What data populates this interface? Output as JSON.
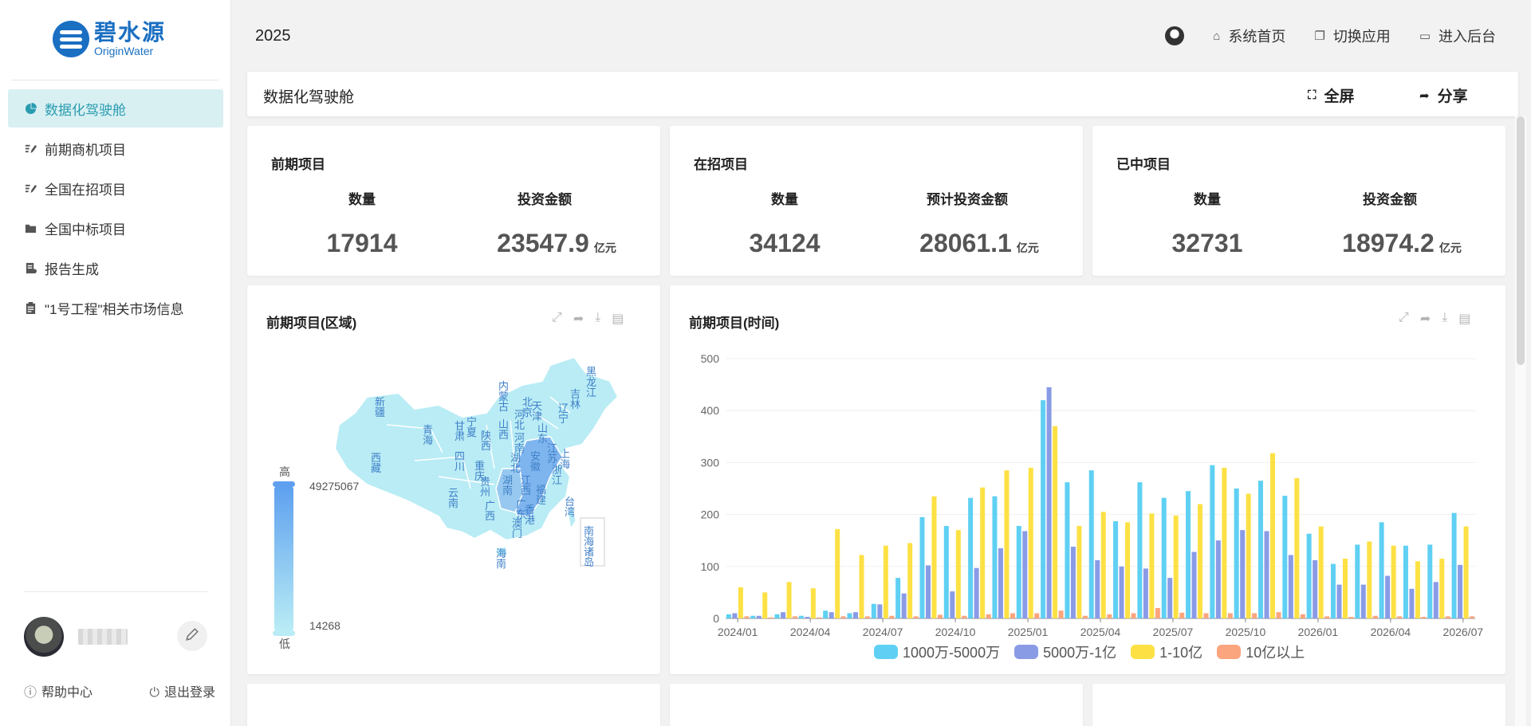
{
  "brand": {
    "cn": "碧水源",
    "en": "OriginWater"
  },
  "sidebar": {
    "items": [
      {
        "label": "数据化驾驶舱",
        "icon": "pie-chart-icon",
        "active": true
      },
      {
        "label": "前期商机项目",
        "icon": "edit-list-icon",
        "active": false
      },
      {
        "label": "全国在招项目",
        "icon": "edit-list-icon",
        "active": false
      },
      {
        "label": "全国中标项目",
        "icon": "folder-icon",
        "active": false
      },
      {
        "label": "报告生成",
        "icon": "report-icon",
        "active": false
      },
      {
        "label": "\"1号工程\"相关市场信息",
        "icon": "clipboard-icon",
        "active": false
      }
    ],
    "help": "帮助中心",
    "logout": "退出登录"
  },
  "topbar": {
    "year": "2025",
    "home": "系统首页",
    "switch_app": "切换应用",
    "backend": "进入后台"
  },
  "titlebar": {
    "title": "数据化驾驶舱",
    "fullscreen": "全屏",
    "share": "分享"
  },
  "stats": [
    {
      "title": "前期项目",
      "count_label": "数量",
      "count": "17914",
      "amount_label": "投资金额",
      "amount": "23547.9",
      "unit": "亿元"
    },
    {
      "title": "在招项目",
      "count_label": "数量",
      "count": "34124",
      "amount_label": "预计投资金额",
      "amount": "28061.1",
      "unit": "亿元"
    },
    {
      "title": "已中项目",
      "count_label": "数量",
      "count": "32731",
      "amount_label": "投资金额",
      "amount": "18974.2",
      "unit": "亿元"
    }
  ],
  "map_panel": {
    "title": "前期项目(区域)",
    "legend_high": "高",
    "legend_low": "低",
    "max_value": "49275067",
    "min_value": "14268",
    "colors": {
      "low": "#b9ecf5",
      "high": "#6aa6ef"
    },
    "provinces": [
      "新疆",
      "西藏",
      "青海",
      "甘肃",
      "宁夏",
      "内蒙古",
      "黑龙江",
      "吉林",
      "辽宁",
      "北京",
      "天津",
      "河北",
      "山西",
      "陕西",
      "四川",
      "重庆",
      "云南",
      "贵州",
      "广西",
      "海南",
      "广东",
      "香港",
      "澳门",
      "湖南",
      "湖北",
      "河南",
      "山东",
      "江苏",
      "上海",
      "安徽",
      "浙江",
      "江西",
      "福建",
      "台湾",
      "南海诸岛"
    ]
  },
  "chart_panel": {
    "title": "前期项目(时间)",
    "chart_data": {
      "type": "bar",
      "ylim": [
        0,
        500
      ],
      "yticks": [
        0,
        100,
        200,
        300,
        400,
        500
      ],
      "xticks": [
        "2024/01",
        "2024/04",
        "2024/07",
        "2024/10",
        "2025/01",
        "2025/04",
        "2025/07",
        "2025/10",
        "2026/01",
        "2026/04",
        "2026/07"
      ],
      "categories": [
        "2024/01",
        "2024/02",
        "2024/03",
        "2024/04",
        "2024/05",
        "2024/06",
        "2024/07",
        "2024/08",
        "2024/09",
        "2024/10",
        "2024/11",
        "2024/12",
        "2025/01",
        "2025/02",
        "2025/03",
        "2025/04",
        "2025/05",
        "2025/06",
        "2025/07",
        "2025/08",
        "2025/09",
        "2025/10",
        "2025/11",
        "2025/12",
        "2026/01",
        "2026/02",
        "2026/03",
        "2026/04",
        "2026/05",
        "2026/06",
        "2026/07"
      ],
      "series": [
        {
          "name": "1000万-5000万",
          "color": "#5fd0f3",
          "values": [
            8,
            5,
            8,
            5,
            15,
            10,
            28,
            78,
            195,
            178,
            232,
            235,
            178,
            420,
            262,
            285,
            187,
            262,
            232,
            245,
            295,
            250,
            265,
            236,
            163,
            105,
            142,
            185,
            140,
            142,
            203
          ]
        },
        {
          "name": "5000万-1亿",
          "color": "#8a9be6",
          "values": [
            10,
            5,
            12,
            3,
            12,
            12,
            27,
            48,
            102,
            52,
            97,
            135,
            168,
            445,
            138,
            112,
            100,
            96,
            78,
            128,
            150,
            170,
            168,
            122,
            112,
            65,
            65,
            82,
            57,
            70,
            103
          ]
        },
        {
          "name": "1-10亿",
          "color": "#fde144",
          "values": [
            60,
            50,
            70,
            58,
            172,
            122,
            140,
            145,
            235,
            170,
            252,
            285,
            290,
            370,
            178,
            205,
            185,
            202,
            198,
            220,
            290,
            240,
            318,
            270,
            177,
            115,
            148,
            140,
            110,
            115,
            177
          ]
        },
        {
          "name": "10亿以上",
          "color": "#fba57e",
          "values": [
            4,
            2,
            4,
            2,
            4,
            4,
            5,
            4,
            7,
            5,
            8,
            10,
            10,
            15,
            5,
            8,
            10,
            20,
            11,
            10,
            10,
            10,
            12,
            8,
            4,
            3,
            5,
            4,
            3,
            4,
            4
          ]
        }
      ]
    }
  }
}
